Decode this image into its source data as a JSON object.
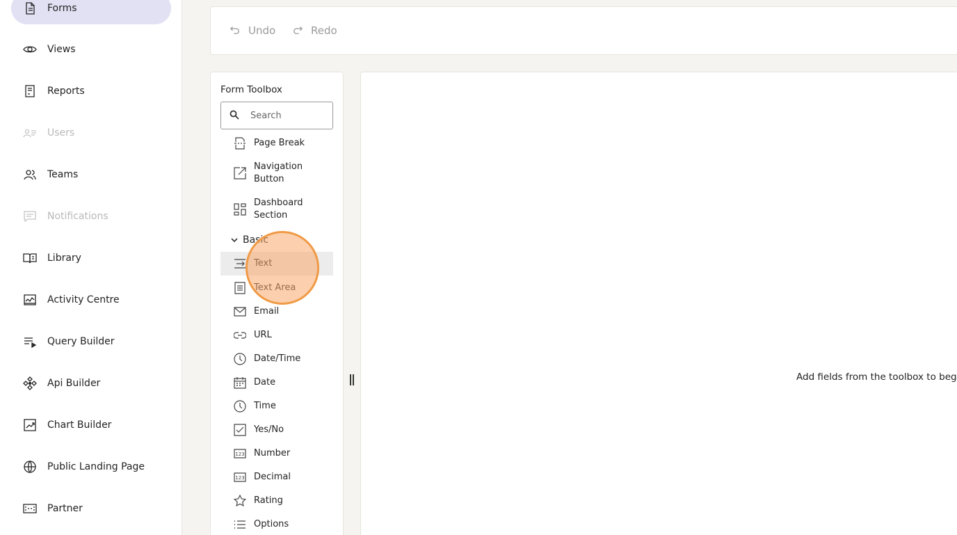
{
  "sidebar": {
    "items": [
      {
        "label": "Forms",
        "icon": "document-icon",
        "active": true,
        "disabled": false
      },
      {
        "label": "Views",
        "icon": "eye-icon",
        "active": false,
        "disabled": false
      },
      {
        "label": "Reports",
        "icon": "report-icon",
        "active": false,
        "disabled": false
      },
      {
        "label": "Users",
        "icon": "users-icon",
        "active": false,
        "disabled": true
      },
      {
        "label": "Teams",
        "icon": "team-icon",
        "active": false,
        "disabled": false
      },
      {
        "label": "Notifications",
        "icon": "message-icon",
        "active": false,
        "disabled": true
      },
      {
        "label": "Library",
        "icon": "book-icon",
        "active": false,
        "disabled": false
      },
      {
        "label": "Activity Centre",
        "icon": "activity-icon",
        "active": false,
        "disabled": false
      },
      {
        "label": "Query Builder",
        "icon": "query-icon",
        "active": false,
        "disabled": false
      },
      {
        "label": "Api Builder",
        "icon": "api-icon",
        "active": false,
        "disabled": false
      },
      {
        "label": "Chart Builder",
        "icon": "chart-icon",
        "active": false,
        "disabled": false
      },
      {
        "label": "Public Landing Page",
        "icon": "globe-icon",
        "active": false,
        "disabled": false
      },
      {
        "label": "Partner",
        "icon": "partner-icon",
        "active": false,
        "disabled": false
      }
    ]
  },
  "toolbar": {
    "undo_label": "Undo",
    "redo_label": "Redo"
  },
  "toolbox": {
    "title": "Form Toolbox",
    "search_placeholder": "Search",
    "layout_items": [
      {
        "label": "Page Break",
        "icon": "page-break-icon"
      },
      {
        "label": "Navigation Button",
        "icon": "navigation-icon"
      },
      {
        "label": "Dashboard Section",
        "icon": "dashboard-icon"
      }
    ],
    "section_label": "Basic",
    "basic_items": [
      {
        "label": "Text",
        "icon": "text-input-icon"
      },
      {
        "label": "Text Area",
        "icon": "text-area-icon"
      },
      {
        "label": "Email",
        "icon": "email-icon"
      },
      {
        "label": "URL",
        "icon": "link-icon"
      },
      {
        "label": "Date/Time",
        "icon": "clock-icon"
      },
      {
        "label": "Date",
        "icon": "calendar-icon"
      },
      {
        "label": "Time",
        "icon": "clock-icon"
      },
      {
        "label": "Yes/No",
        "icon": "checkbox-icon"
      },
      {
        "label": "Number",
        "icon": "number-icon"
      },
      {
        "label": "Decimal",
        "icon": "decimal-icon"
      },
      {
        "label": "Rating",
        "icon": "star-icon"
      },
      {
        "label": "Options",
        "icon": "list-icon"
      }
    ]
  },
  "canvas": {
    "empty_message": "Add fields from the toolbox to begin"
  },
  "colors": {
    "active_nav": "#e2e1f4",
    "highlight_row": "#ececec",
    "cursor_ring": "#f09a45"
  }
}
